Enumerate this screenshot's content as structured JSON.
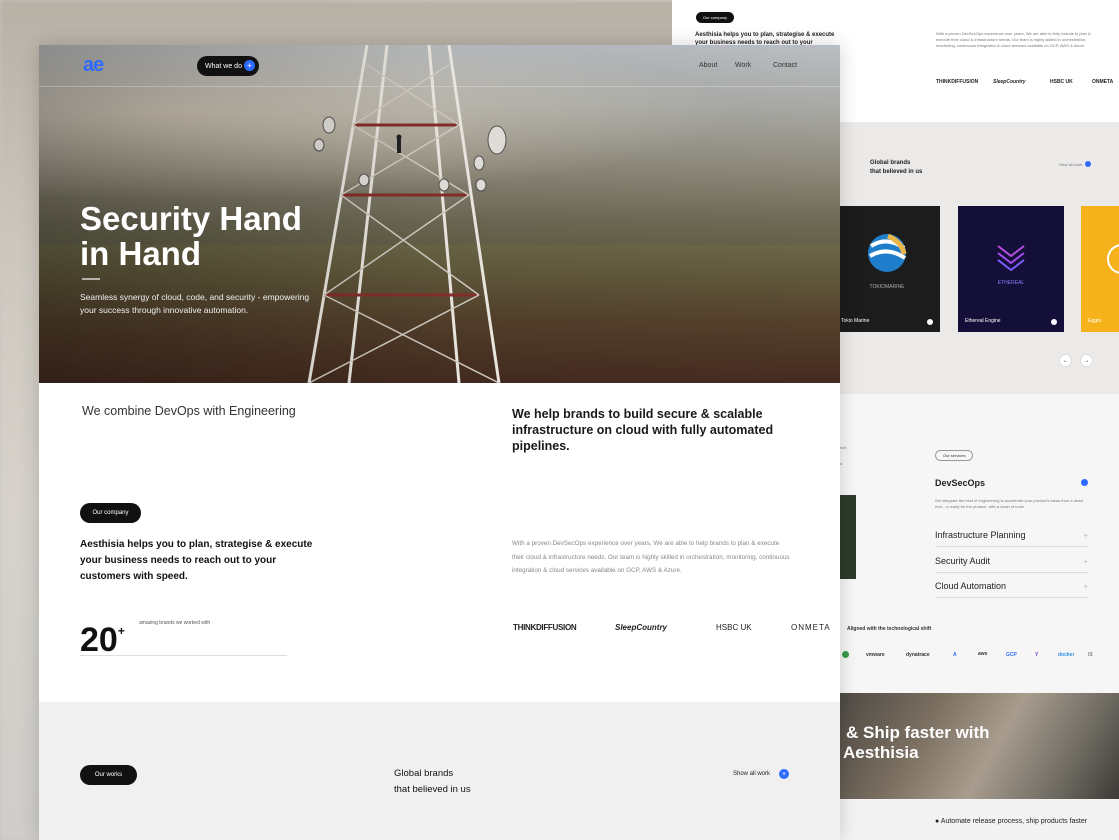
{
  "nav": {
    "logo": "ae",
    "what_we_do": "What we do",
    "what_we_do_icon": "+",
    "links": [
      "About",
      "Work",
      "Contact"
    ]
  },
  "hero": {
    "title_line1": "Security Hand",
    "title_line2": "in Hand",
    "subtitle": "Seamless synergy of cloud, code, and security - empowering your success through innovative automation."
  },
  "intro": {
    "combine": "We combine DevOps with Engineering",
    "help": "We help brands to build secure & scalable infrastructure on cloud with fully automated pipelines."
  },
  "company": {
    "pill": "Our company",
    "headline": "Aesthisia helps you to plan, strategise & execute your business needs to reach out to your customers with speed.",
    "proven": "With a proven DevSecOps experience over years, We are able to help brands to plan & execute their cloud & infrastructure needs. Our team is highly skilled in orchestration, monitoring, continuous integration & cloud services available on GCP, AWS & Azure.",
    "stat_number": "20",
    "stat_sup": "+",
    "stat_label": "amazing brands we worked with",
    "brands": [
      "THINKDIFFUSION",
      "SleepCountry",
      "HSBC UK",
      "ONMETA"
    ]
  },
  "works": {
    "pill": "Our works",
    "title_line1": "Global brands",
    "title_line2": "that believed in us",
    "show_all": "Show all work",
    "show_all_icon": "+"
  },
  "side": {
    "company_pill": "Our company",
    "company_headline": "Aesthisia helps you to plan, strategise & execute your business needs to reach out to your",
    "proven": "With a proven DevSecOps experience over years, We are able to help brands to plan & execute their cloud & infrastructure needs. Our team is highly skilled in orchestration, monitoring, continuous integration & cloud services available on GCP, AWS & Azure.",
    "brands": [
      "THINKDIFFUSION",
      "SleepCountry",
      "HSBC UK",
      "ONMETA"
    ],
    "global_line1": "Global brands",
    "global_line2": "that believed in us",
    "view_all": "View all work",
    "cards": [
      {
        "name": "Tokio Marine",
        "logo": "TOKIOMARINE",
        "color": "#1c1c1c"
      },
      {
        "name": "Ethereal Engine",
        "logo": "ETHEREAL",
        "color": "#140f38"
      },
      {
        "name": "Eggro",
        "logo": "",
        "color": "#f5b21b"
      }
    ],
    "prev_icon": "←",
    "next_icon": "→",
    "services_pill": "Our services",
    "services_partial": "nch",
    "services_partial2": "a",
    "services": [
      {
        "label": "DevSecOps",
        "desc": "We integrate the best of engineering to accelerate your product's ideas from a dead end... a ready for the product, with a chain of tools"
      },
      {
        "label": "Infrastructure Planning"
      },
      {
        "label": "Security Audit"
      },
      {
        "label": "Cloud Automation"
      }
    ],
    "aligned": "Aligned with the technological shift",
    "tech": [
      "vmware",
      "dynatrace",
      "A",
      "aws",
      "GCP",
      "Y",
      "docker",
      "IS"
    ],
    "ship_line1": "& Ship faster with",
    "ship_line2": "Aesthisia",
    "automate": "Automate release process, ship products faster"
  }
}
